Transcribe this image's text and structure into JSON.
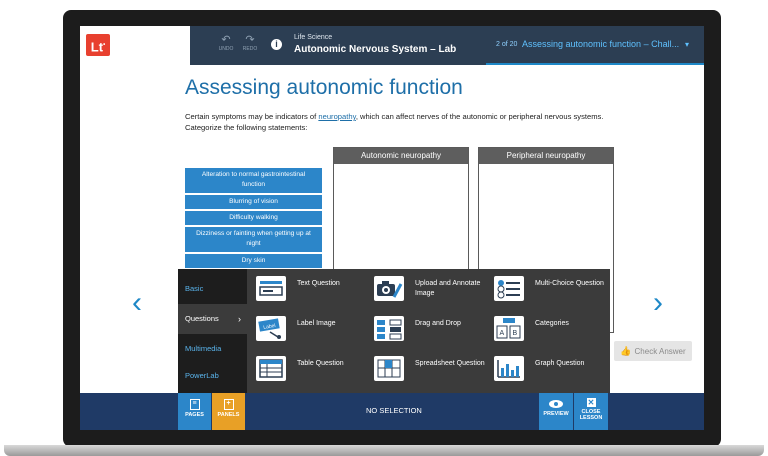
{
  "header": {
    "logo": "Lt",
    "undo_label": "UNDO",
    "redo_label": "REDO",
    "info_icon": "i",
    "course_kicker": "Life Science",
    "course_title": "Autonomic Nervous System – Lab",
    "page_count": "2 of 20",
    "page_current": "Assessing autonomic function – Chall...",
    "dropdown_icon": "▾"
  },
  "content": {
    "heading": "Assessing autonomic function",
    "intro_before": "Certain symptoms may be indicators of ",
    "intro_link": "neuropathy",
    "intro_after": ", which can affect nerves of the autonomic or peripheral nervous systems. Categorize the following statements:",
    "categories": [
      "Autonomic neuropathy",
      "Peripheral neuropathy"
    ],
    "statements": [
      "Alteration to normal gastrointestinal function",
      "Blurring of vision",
      "Difficulty walking",
      "Dizziness or fainting when getting up at night",
      "Dry skin"
    ],
    "check_answer": "Check Answer"
  },
  "panel": {
    "side": [
      "Basic",
      "Questions",
      "Multimedia",
      "PowerLab"
    ],
    "active_side": "Questions",
    "tools": [
      "Text Question",
      "Upload and Annotate Image",
      "Multi-Choice Question",
      "Label Image",
      "Drag and Drop",
      "Categories",
      "Table Question",
      "Spreadsheet Question",
      "Graph Question"
    ]
  },
  "toolbar": {
    "pages": "PAGES",
    "panels": "PANELS",
    "status": "NO SELECTION",
    "preview": "PREVIEW",
    "close1": "CLOSE",
    "close2": "LESSON"
  },
  "colors": {
    "accent": "#1e88c7",
    "topbar": "#2c3e53",
    "statement": "#2c86c9",
    "panels_tab": "#e8a026",
    "bottombar": "#1f3a66"
  }
}
